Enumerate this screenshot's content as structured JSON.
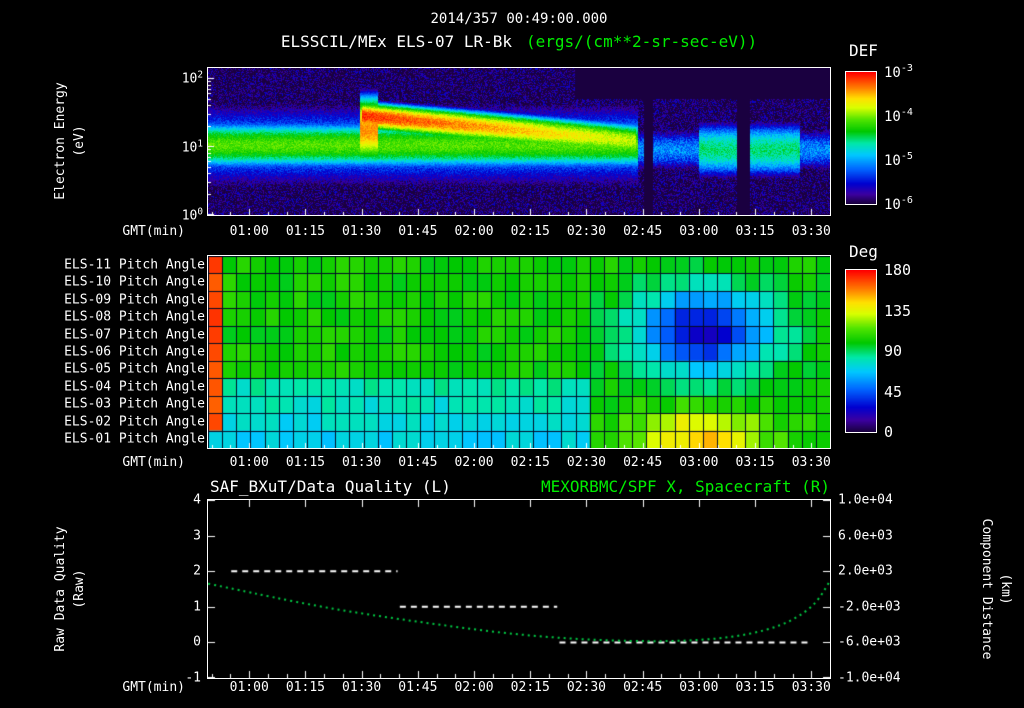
{
  "colors": {
    "background": "#000000",
    "text": "#ffffff",
    "accent_green": "#00ee00",
    "curve_green": "#00cc44",
    "quality_white": "#ffffff",
    "grid_dark": "#030d26",
    "rainbow": [
      [
        0,
        "#1a0040"
      ],
      [
        0.07,
        "#3c00a0"
      ],
      [
        0.15,
        "#0000d0"
      ],
      [
        0.26,
        "#0064ff"
      ],
      [
        0.37,
        "#00c8ff"
      ],
      [
        0.46,
        "#00e8a8"
      ],
      [
        0.55,
        "#00c800"
      ],
      [
        0.64,
        "#50e400"
      ],
      [
        0.73,
        "#d8ff00"
      ],
      [
        0.8,
        "#ffe000"
      ],
      [
        0.88,
        "#ff8000"
      ],
      [
        1,
        "#ff0000"
      ]
    ]
  },
  "header": {
    "timestamp": "2014/357 00:49:00.000",
    "title_left": "ELSSCIL/MEx ELS-07 LR-Bk",
    "title_units": "(ergs/(cm**2-sr-sec-eV))"
  },
  "axes": {
    "gmt_label": "GMT(min)",
    "time_ticks": [
      "01:00",
      "01:15",
      "01:30",
      "01:45",
      "02:00",
      "02:15",
      "02:30",
      "02:45",
      "03:00",
      "03:15",
      "03:30"
    ],
    "time_tick_hours": [
      1.0,
      1.25,
      1.5,
      1.75,
      2.0,
      2.25,
      2.5,
      2.75,
      3.0,
      3.25,
      3.5
    ]
  },
  "spectrogram": {
    "ylabel_line1": "Electron Energy",
    "ylabel_line2": "(eV)",
    "ytick_base": "10",
    "ytick_exponents": [
      "2",
      "1",
      "0"
    ],
    "colorbar_title": "DEF",
    "colorbar_base": "10",
    "colorbar_exponents": [
      "-3",
      "-4",
      "-5",
      "-6"
    ]
  },
  "pitch": {
    "row_labels": [
      "ELS-11 Pitch Angle",
      "ELS-10 Pitch Angle",
      "ELS-09 Pitch Angle",
      "ELS-08 Pitch Angle",
      "ELS-07 Pitch Angle",
      "ELS-06 Pitch Angle",
      "ELS-05 Pitch Angle",
      "ELS-04 Pitch Angle",
      "ELS-03 Pitch Angle",
      "ELS-02 Pitch Angle",
      "ELS-01 Pitch Angle"
    ],
    "colorbar_title": "Deg",
    "colorbar_ticks": [
      "180",
      "135",
      "90",
      "45",
      "0"
    ]
  },
  "lineplot": {
    "title_left": "SAF_BXuT/Data Quality (L)",
    "title_right": "MEXORBMC/SPF X, Spacecraft (R)",
    "ylabel_line1": "Raw Data Quality",
    "ylabel_line2": "(Raw)",
    "left_ticks": [
      "4",
      "3",
      "2",
      "1",
      "0",
      "-1"
    ],
    "right_ylabel_line1": "Component Distance",
    "right_ylabel_line2": "(km)",
    "right_ticks": [
      "1.0e+04",
      "6.0e+03",
      "2.0e+03",
      "-2.0e+03",
      "-6.0e+03",
      "-1.0e+04"
    ]
  },
  "chart_data": [
    {
      "type": "heatmap",
      "panel": "electron_energy_spectrogram",
      "title": "ELSSCIL/MEx ELS-07 LR-Bk",
      "units": "ergs/(cm**2-sr-sec-eV)",
      "time_start": "00:49",
      "time_end": "03:35",
      "x_range_hours": [
        0.8167,
        3.5833
      ],
      "y_scale": "log",
      "y_range_ev": [
        1,
        141
      ],
      "flux_log10_range": [
        -6,
        -3
      ],
      "description": "Green flux band near 10 eV from 00:49; hot red injection ridge starting ~28 eV at 01:30 decaying to ~12 eV by 02:40; low blue flux with dark vertical dropouts after 02:45; faint green patch 03:00-03:25.",
      "model": {
        "background_log_flux": -6.05,
        "background_noise": 0.55,
        "band": {
          "center_log_ev": 1.02,
          "sigma": 0.28,
          "peak_log_flux": -4.1,
          "t_end": 2.73
        },
        "halo": {
          "sigma": 0.6,
          "peak_log_flux": -5.05
        },
        "injection": {
          "t_start": 1.5,
          "t_end": 2.72,
          "center_start": 1.45,
          "center_end": 1.08,
          "peak_start": -3.1,
          "peak_end": -3.85,
          "sigma_start": 0.15,
          "sigma_end": 0.2
        },
        "onset": {
          "t_start": 1.49,
          "t_end": 1.57,
          "center": 1.25,
          "sigma": 0.38,
          "peak": -3.4
        },
        "post_band": {
          "t_start": 2.73,
          "center": 0.95,
          "sigma": 0.3,
          "peak": -5.1
        },
        "post_patch": {
          "t_start": 3.0,
          "t_end": 3.45,
          "center": 0.95,
          "sigma": 0.35,
          "peak": -4.55
        },
        "dark_streaks": [
          [
            2.755,
            2.795
          ],
          [
            3.17,
            3.23
          ]
        ],
        "top_dark": {
          "t_start": 2.45,
          "log_ev_min": 1.7,
          "delta": -0.5
        }
      }
    },
    {
      "type": "heatmap",
      "panel": "pitch_angles",
      "rows_top_to_bottom": [
        "ELS-11",
        "ELS-10",
        "ELS-09",
        "ELS-08",
        "ELS-07",
        "ELS-06",
        "ELS-05",
        "ELS-04",
        "ELS-03",
        "ELS-02",
        "ELS-01"
      ],
      "value_units": "Deg",
      "value_range": [
        0,
        180
      ],
      "cols": 44,
      "description": "Mostly ~100 deg (green); lower anodes ~75 deg (cyan) until 02:30; deep blue ~25 deg blob 02:45-03:20 around ELS-06..ELS-09; yellow ~150 deg patch on ELS-01/02 near 03:00; red ~168 deg strip at left edge.",
      "model": {
        "base_deg": 102,
        "bottom_rows_deg": 70,
        "bottom_rows_count": 4,
        "bottom_transition_t": 2.5,
        "blue_blob": {
          "t_center": 3.02,
          "t_sigma": 0.3,
          "row_center_from_bottom": 6.2,
          "row_sigma": 2.4,
          "depth_deg": 78
        },
        "yellow_patch": {
          "t_center": 3.0,
          "t_sigma": 0.28,
          "row_center_from_bottom": 0.3,
          "row_sigma": 1.3,
          "height_deg": 48
        },
        "red_strip_t_end": 0.875,
        "red_strip_deg": 168,
        "noise_deg": 6
      }
    },
    {
      "type": "line",
      "panel": "quality_and_distance",
      "x_range_hours": [
        0.8167,
        3.5833
      ],
      "left_axis": {
        "label": "Raw Data Quality (Raw)",
        "range": [
          -1,
          4
        ]
      },
      "right_axis": {
        "label": "Component Distance (km)",
        "range": [
          -10000,
          10000
        ]
      },
      "series": [
        {
          "name": "SAF_BXuT/Data Quality (L)",
          "axis": "left",
          "color": "#ffffff",
          "style": "dashed",
          "segments": [
            {
              "t_start": 0.92,
              "t_end": 1.66,
              "value": 2
            },
            {
              "t_start": 1.67,
              "t_end": 2.37,
              "value": 1
            },
            {
              "t_start": 2.38,
              "t_end": 3.5,
              "value": 0
            }
          ]
        },
        {
          "name": "MEXORBMC/SPF X, Spacecraft (R)",
          "axis": "right",
          "color": "#00cc44",
          "style": "dotted",
          "points": [
            [
              0.817,
              600
            ],
            [
              0.95,
              -100
            ],
            [
              1.1,
              -900
            ],
            [
              1.3,
              -1900
            ],
            [
              1.5,
              -2750
            ],
            [
              1.7,
              -3500
            ],
            [
              1.9,
              -4200
            ],
            [
              2.1,
              -4850
            ],
            [
              2.3,
              -5350
            ],
            [
              2.5,
              -5680
            ],
            [
              2.7,
              -5850
            ],
            [
              2.85,
              -5870
            ],
            [
              3.0,
              -5750
            ],
            [
              3.15,
              -5400
            ],
            [
              3.3,
              -4650
            ],
            [
              3.42,
              -3500
            ],
            [
              3.52,
              -1700
            ],
            [
              3.583,
              900
            ]
          ]
        }
      ]
    }
  ]
}
